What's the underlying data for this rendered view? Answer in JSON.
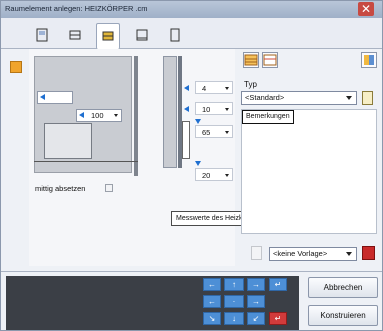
{
  "window": {
    "title": "Raumelement anlegen: HEIZKÖRPER .cm"
  },
  "tabs": [
    {
      "name": "tab-1"
    },
    {
      "name": "tab-2"
    },
    {
      "name": "tab-3"
    },
    {
      "name": "tab-4"
    },
    {
      "name": "tab-5"
    }
  ],
  "fields": {
    "width_top": "",
    "width_main": "100",
    "side_1": "4",
    "side_2": "10",
    "side_3": "65",
    "side_4": "20"
  },
  "checkbox": {
    "label": "mittig absetzen"
  },
  "tooltip": {
    "text": "Messwerte des Heizkörpers"
  },
  "right_panel": {
    "typ_label": "Typ",
    "typ_value": "<Standard>",
    "bemerkungen_label": "Bemerkungen"
  },
  "vorlage": {
    "value": "<keine Vorlage>"
  },
  "buttons": {
    "cancel": "Abbrechen",
    "construct": "Konstruieren"
  },
  "colors": {
    "accent_blue": "#1f6fd0",
    "keypad_blue": "#4d8fd6",
    "danger_red": "#c82a2a",
    "dark_panel": "#3b3f46"
  }
}
